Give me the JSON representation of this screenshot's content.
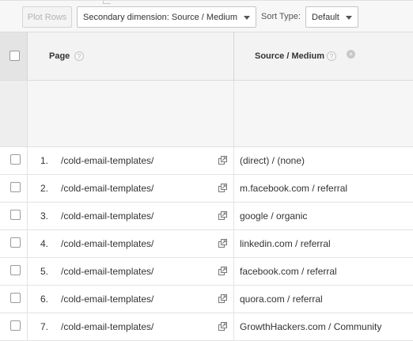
{
  "toolbar": {
    "plot_rows_label": "Plot Rows",
    "secondary_dimension_label": "Secondary dimension: Source / Medium",
    "sort_type_label": "Sort Type:",
    "sort_type_value": "Default"
  },
  "table": {
    "headers": {
      "page": "Page",
      "source_medium": "Source / Medium",
      "help_glyph": "?",
      "remove_glyph": "×"
    },
    "rows": [
      {
        "num": "1.",
        "page": "/cold-email-templates/",
        "source": "(direct) / (none)"
      },
      {
        "num": "2.",
        "page": "/cold-email-templates/",
        "source": "m.facebook.com / referral"
      },
      {
        "num": "3.",
        "page": "/cold-email-templates/",
        "source": "google / organic"
      },
      {
        "num": "4.",
        "page": "/cold-email-templates/",
        "source": "linkedin.com / referral"
      },
      {
        "num": "5.",
        "page": "/cold-email-templates/",
        "source": "facebook.com / referral"
      },
      {
        "num": "6.",
        "page": "/cold-email-templates/",
        "source": "quora.com / referral"
      },
      {
        "num": "7.",
        "page": "/cold-email-templates/",
        "source": "GrowthHackers.com / Community"
      }
    ]
  },
  "icons": {
    "help": "question-circle-icon",
    "remove": "remove-dimension-icon",
    "popout": "open-in-new-window-icon",
    "caret": "caret-down-icon"
  },
  "colors": {
    "header_bg": "#f3f3f3",
    "summary_bg": "#f6f6f6",
    "text": "#333333",
    "disabled_text": "#b3b3b3"
  }
}
